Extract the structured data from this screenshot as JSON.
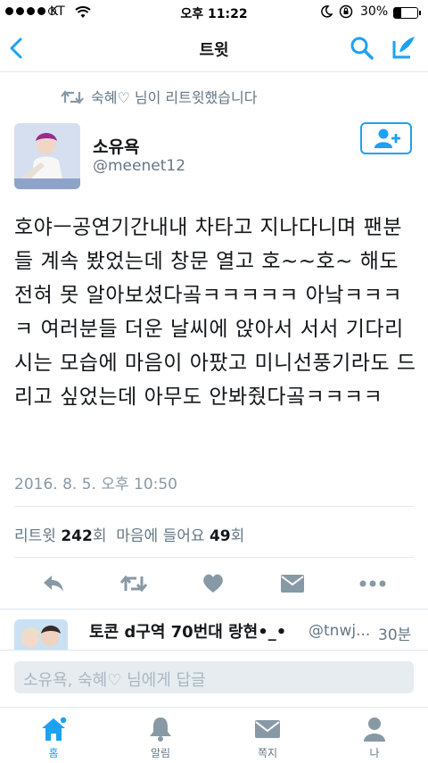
{
  "status_bar": {
    "carrier": "KT",
    "time": "오후 11:22",
    "battery": "30%"
  },
  "nav": {
    "title": "트윗",
    "back_icon": "back-chevron-icon",
    "search_icon": "search-icon",
    "compose_icon": "compose-icon"
  },
  "retweet_notice": "숙혜♡ 님이 리트윗했습니다",
  "tweet": {
    "name": "소유욕",
    "handle": "@meenet12",
    "text": "호야ㅡ공연기간내내 차타고 지나다니며 팬분들 계속 봤었는데 창문 열고 호~~호~ 해도 전혀 못 알아보셨다곸ㅋㅋㅋㅋㅋ 아낰ㅋㅋㅋㅋ 여러분들 더운 날씨에 앉아서 서서 기다리시는 모습에 마음이 아팠고 미니선풍기라도 드리고 싶었는데 아무도 안봐줬다곸ㅋㅋㅋㅋ",
    "date": "2016. 8. 5. 오후 10:50",
    "retweet_label": "리트윗",
    "retweet_count": "242",
    "unit": "회",
    "like_label": "마음에 들어요",
    "like_count": "49"
  },
  "reply": {
    "name": "토콘 d구역 70번대 랑현•_•",
    "handle": "@tnwj...",
    "time": "30분"
  },
  "composer": {
    "placeholder": "소유욕, 숙혜♡ 님에게 답글"
  },
  "tabs": [
    {
      "label": "홈",
      "icon": "home-icon",
      "active": true
    },
    {
      "label": "알림",
      "icon": "bell-icon",
      "active": false
    },
    {
      "label": "쪽지",
      "icon": "envelope-icon",
      "active": false
    },
    {
      "label": "나",
      "icon": "person-icon",
      "active": false
    }
  ],
  "colors": {
    "accent": "#1da1f2",
    "muted": "#657786"
  }
}
